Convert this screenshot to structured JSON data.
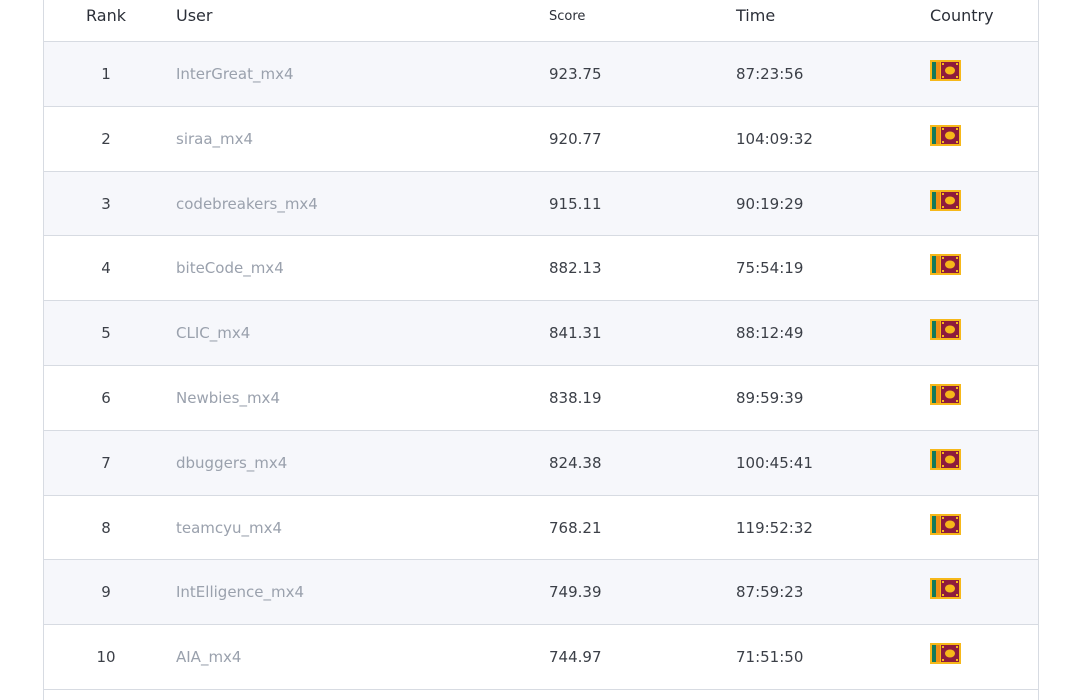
{
  "columns": {
    "rank": "Rank",
    "user": "User",
    "score": "Score",
    "time": "Time",
    "country": "Country"
  },
  "colors": {
    "flag_border": "#f6b81a",
    "flag_green": "#14795a",
    "flag_orange": "#f08e15",
    "flag_maroon": "#8d1b3d",
    "user_link": "#9aa1ad"
  },
  "rows": [
    {
      "rank": "1",
      "user": "InterGreat_mx4",
      "score": "923.75",
      "time": "87:23:56",
      "country_icon": "sri-lanka-flag-icon"
    },
    {
      "rank": "2",
      "user": "siraa_mx4",
      "score": "920.77",
      "time": "104:09:32",
      "country_icon": "sri-lanka-flag-icon"
    },
    {
      "rank": "3",
      "user": "codebreakers_mx4",
      "score": "915.11",
      "time": "90:19:29",
      "country_icon": "sri-lanka-flag-icon"
    },
    {
      "rank": "4",
      "user": "biteCode_mx4",
      "score": "882.13",
      "time": "75:54:19",
      "country_icon": "sri-lanka-flag-icon"
    },
    {
      "rank": "5",
      "user": "CLIC_mx4",
      "score": "841.31",
      "time": "88:12:49",
      "country_icon": "sri-lanka-flag-icon"
    },
    {
      "rank": "6",
      "user": "Newbies_mx4",
      "score": "838.19",
      "time": "89:59:39",
      "country_icon": "sri-lanka-flag-icon"
    },
    {
      "rank": "7",
      "user": "dbuggers_mx4",
      "score": "824.38",
      "time": "100:45:41",
      "country_icon": "sri-lanka-flag-icon"
    },
    {
      "rank": "8",
      "user": "teamcyu_mx4",
      "score": "768.21",
      "time": "119:52:32",
      "country_icon": "sri-lanka-flag-icon"
    },
    {
      "rank": "9",
      "user": "IntElligence_mx4",
      "score": "749.39",
      "time": "87:59:23",
      "country_icon": "sri-lanka-flag-icon"
    },
    {
      "rank": "10",
      "user": "AIA_mx4",
      "score": "744.97",
      "time": "71:51:50",
      "country_icon": "sri-lanka-flag-icon"
    }
  ]
}
